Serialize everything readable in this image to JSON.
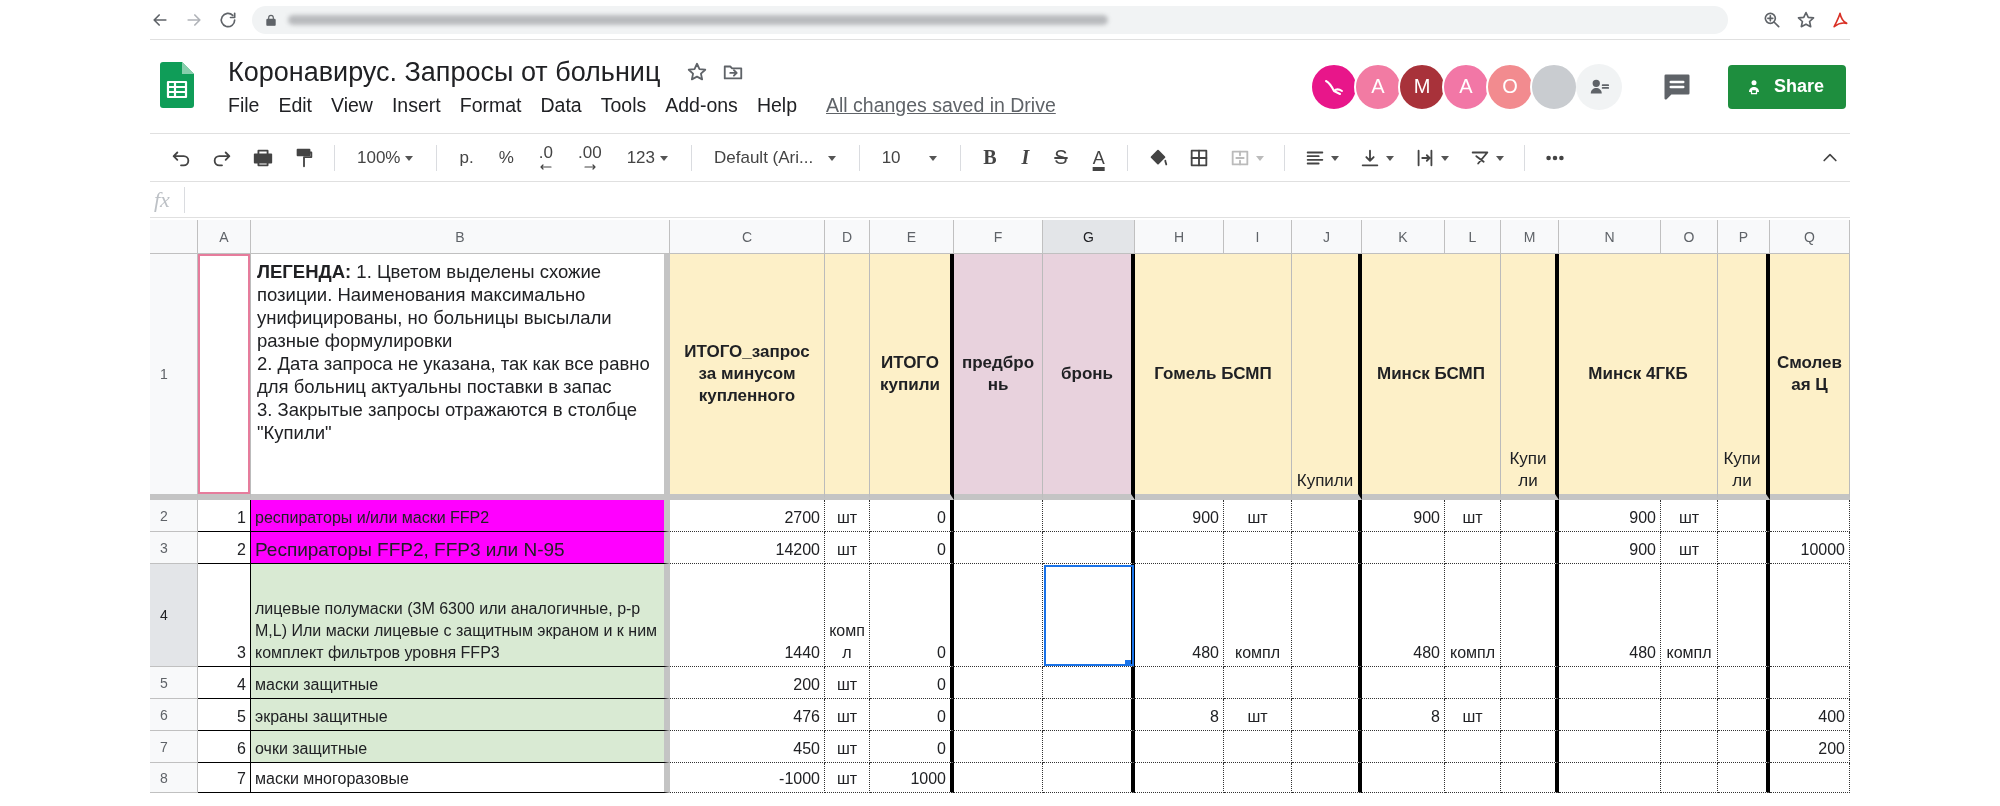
{
  "app": {
    "title": "Коронавирус. Запросы от больниц",
    "menu": [
      "File",
      "Edit",
      "View",
      "Insert",
      "Format",
      "Data",
      "Tools",
      "Add-ons",
      "Help"
    ],
    "save_status": "All changes saved in Drive",
    "collaborators": [
      {
        "kind": "animal",
        "color": "#e8168a"
      },
      {
        "kind": "letter",
        "initial": "A",
        "color": "#f27ba3"
      },
      {
        "kind": "letter",
        "initial": "M",
        "color": "#a8323a"
      },
      {
        "kind": "letter",
        "initial": "A",
        "color": "#f277a6"
      },
      {
        "kind": "letter",
        "initial": "O",
        "color": "#f28b8f"
      },
      {
        "kind": "photo"
      }
    ],
    "share_button": "Share"
  },
  "toolbar": {
    "zoom": "100%",
    "currency": "р.",
    "percent": "%",
    "decrease_decimals": ".0",
    "increase_decimals": ".00",
    "number_format": "123",
    "font": "Default (Ari...",
    "font_size": "10",
    "bold": "B",
    "italic": "I",
    "strikethrough": "S",
    "text_color": "A"
  },
  "formula_bar": {
    "label": "fx"
  },
  "sheet": {
    "columns": [
      {
        "letter": "A",
        "selected": false
      },
      {
        "letter": "B",
        "selected": false
      },
      {
        "letter": "C",
        "selected": false
      },
      {
        "letter": "D",
        "selected": false
      },
      {
        "letter": "E",
        "selected": false
      },
      {
        "letter": "F",
        "selected": false
      },
      {
        "letter": "G",
        "selected": true
      },
      {
        "letter": "H",
        "selected": false
      },
      {
        "letter": "I",
        "selected": false
      },
      {
        "letter": "J",
        "selected": false
      },
      {
        "letter": "K",
        "selected": false
      },
      {
        "letter": "L",
        "selected": false
      },
      {
        "letter": "M",
        "selected": false
      },
      {
        "letter": "N",
        "selected": false
      },
      {
        "letter": "O",
        "selected": false
      },
      {
        "letter": "P",
        "selected": false
      },
      {
        "letter": "Q",
        "selected": false
      }
    ],
    "rows": [
      {
        "number": "1",
        "selected": false,
        "cells": [
          {
            "kind": "empty",
            "selected": false,
            "collaborator_cursor": true
          },
          {
            "kind": "legend",
            "text": "**ЛЕГЕНДА:** 1. Цветом выделены схожие позиции. Наименования максимально унифицированы, но больницы высылали разные формулировки\n2. Дата запроса не указана, так как все равно для больниц актуальны поставки в запас\n3. Закрытые запросы отражаются в столбце \"Купили\"",
            "selected": false
          },
          {
            "kind": "header",
            "text": "ИТОГО_запрос за минусом купленного",
            "color": "#fdf0c8",
            "selected": false
          },
          {
            "kind": "empty",
            "color": "#fdf0c8",
            "selected": false
          },
          {
            "kind": "header",
            "text": "ИТОГО купили",
            "color": "#fdf0c8",
            "selected": false
          },
          {
            "kind": "header",
            "text": "предбронь",
            "color": "#e8d2dd",
            "selected": false
          },
          {
            "kind": "header",
            "text": "бронь",
            "color": "#e8d2dd",
            "selected": false
          },
          {
            "kind": "header",
            "text": "Гомель БСМП",
            "color": "#fdf0c8",
            "merged": true,
            "selected": false
          },
          {
            "kind": "covered"
          },
          {
            "kind": "note",
            "text": "Купили",
            "color": "#fdf0c8",
            "selected": false
          },
          {
            "kind": "header",
            "text": "Минск БСМП",
            "color": "#fdf0c8",
            "merged": true,
            "selected": false
          },
          {
            "kind": "covered"
          },
          {
            "kind": "note",
            "text": "Купили",
            "color": "#fdf0c8",
            "selected": false
          },
          {
            "kind": "header",
            "text": "Минск 4ГКБ",
            "color": "#fdf0c8",
            "merged": true,
            "selected": false
          },
          {
            "kind": "covered"
          },
          {
            "kind": "note",
            "text": "Купили",
            "color": "#fdf0c8",
            "selected": false
          },
          {
            "kind": "header",
            "text": "Смолевая Ц",
            "color": "#fdf0c8",
            "selected": false
          }
        ]
      },
      {
        "number": "2",
        "selected": false,
        "cells": [
          {
            "kind": "index",
            "text": "1",
            "selected": false
          },
          {
            "kind": "item",
            "text": "респираторы и/или маски FFP2",
            "color": "#ff00ff",
            "selected": false
          },
          {
            "kind": "number",
            "text": "2700",
            "selected": false
          },
          {
            "kind": "unit",
            "text": "шт",
            "selected": false
          },
          {
            "kind": "number",
            "text": "0",
            "selected": false
          },
          {
            "kind": "empty",
            "selected": false
          },
          {
            "kind": "empty",
            "selected": false
          },
          {
            "kind": "number",
            "text": "900",
            "selected": false
          },
          {
            "kind": "unit",
            "text": "шт",
            "selected": false
          },
          {
            "kind": "empty",
            "selected": false
          },
          {
            "kind": "number",
            "text": "900",
            "selected": false
          },
          {
            "kind": "unit",
            "text": "шт",
            "selected": false
          },
          {
            "kind": "empty",
            "selected": false
          },
          {
            "kind": "number",
            "text": "900",
            "selected": false
          },
          {
            "kind": "unit",
            "text": "шт",
            "selected": false
          },
          {
            "kind": "empty",
            "selected": false
          },
          {
            "kind": "empty",
            "selected": false
          }
        ]
      },
      {
        "number": "3",
        "selected": false,
        "cells": [
          {
            "kind": "index",
            "text": "2",
            "selected": false
          },
          {
            "kind": "large",
            "text": "Респираторы FFP2, FFP3 или N-95",
            "color": "#ff00ff",
            "selected": false
          },
          {
            "kind": "number",
            "text": "14200",
            "selected": false
          },
          {
            "kind": "unit",
            "text": "шт",
            "selected": false
          },
          {
            "kind": "number",
            "text": "0",
            "selected": false
          },
          {
            "kind": "empty",
            "selected": false
          },
          {
            "kind": "empty",
            "selected": false
          },
          {
            "kind": "empty",
            "selected": false
          },
          {
            "kind": "empty",
            "selected": false
          },
          {
            "kind": "empty",
            "selected": false
          },
          {
            "kind": "empty",
            "selected": false
          },
          {
            "kind": "empty",
            "selected": false
          },
          {
            "kind": "empty",
            "selected": false
          },
          {
            "kind": "number",
            "text": "900",
            "selected": false
          },
          {
            "kind": "unit",
            "text": "шт",
            "selected": false
          },
          {
            "kind": "empty",
            "selected": false
          },
          {
            "kind": "number",
            "text": "10000",
            "selected": false
          }
        ]
      },
      {
        "number": "4",
        "selected": true,
        "cells": [
          {
            "kind": "index",
            "text": "3",
            "selected": false
          },
          {
            "kind": "item",
            "text": "лицевые полумаски (3М 6300 или аналогичные, р-р M,L) Или маски лицевые с защитным экраном и к ним комплект фильтров уровня FFP3",
            "color": "#d9ead3",
            "selected": false
          },
          {
            "kind": "number",
            "text": "1440",
            "selected": false
          },
          {
            "kind": "unit",
            "text": "компл",
            "selected": false
          },
          {
            "kind": "number",
            "text": "0",
            "selected": false
          },
          {
            "kind": "empty",
            "selected": false
          },
          {
            "kind": "empty",
            "selected": true
          },
          {
            "kind": "number",
            "text": "480",
            "selected": false
          },
          {
            "kind": "unit",
            "text": "компл",
            "selected": false
          },
          {
            "kind": "empty",
            "selected": false
          },
          {
            "kind": "number",
            "text": "480",
            "selected": false
          },
          {
            "kind": "unit",
            "text": "компл",
            "selected": false
          },
          {
            "kind": "empty",
            "selected": false
          },
          {
            "kind": "number",
            "text": "480",
            "selected": false
          },
          {
            "kind": "unit",
            "text": "компл",
            "selected": false
          },
          {
            "kind": "empty",
            "selected": false
          },
          {
            "kind": "empty",
            "selected": false
          }
        ]
      },
      {
        "number": "5",
        "selected": false,
        "cells": [
          {
            "kind": "index",
            "text": "4",
            "selected": false
          },
          {
            "kind": "item",
            "text": "маски защитные",
            "color": "#d9ead3",
            "selected": false
          },
          {
            "kind": "number",
            "text": "200",
            "selected": false
          },
          {
            "kind": "unit",
            "text": "шт",
            "selected": false
          },
          {
            "kind": "number",
            "text": "0",
            "selected": false
          },
          {
            "kind": "empty",
            "selected": false
          },
          {
            "kind": "empty",
            "selected": false
          },
          {
            "kind": "empty",
            "selected": false
          },
          {
            "kind": "empty",
            "selected": false
          },
          {
            "kind": "empty",
            "selected": false
          },
          {
            "kind": "empty",
            "selected": false
          },
          {
            "kind": "empty",
            "selected": false
          },
          {
            "kind": "empty",
            "selected": false
          },
          {
            "kind": "empty",
            "selected": false
          },
          {
            "kind": "empty",
            "selected": false
          },
          {
            "kind": "empty",
            "selected": false
          },
          {
            "kind": "empty",
            "selected": false
          }
        ]
      },
      {
        "number": "6",
        "selected": false,
        "cells": [
          {
            "kind": "index",
            "text": "5",
            "selected": false
          },
          {
            "kind": "item",
            "text": "экраны защитные",
            "color": "#d9ead3",
            "selected": false
          },
          {
            "kind": "number",
            "text": "476",
            "selected": false
          },
          {
            "kind": "unit",
            "text": "шт",
            "selected": false
          },
          {
            "kind": "number",
            "text": "0",
            "selected": false
          },
          {
            "kind": "empty",
            "selected": false
          },
          {
            "kind": "empty",
            "selected": false
          },
          {
            "kind": "number",
            "text": "8",
            "selected": false
          },
          {
            "kind": "unit",
            "text": "шт",
            "selected": false
          },
          {
            "kind": "empty",
            "selected": false
          },
          {
            "kind": "number",
            "text": "8",
            "selected": false
          },
          {
            "kind": "unit",
            "text": "шт",
            "selected": false
          },
          {
            "kind": "empty",
            "selected": false
          },
          {
            "kind": "empty",
            "selected": false
          },
          {
            "kind": "empty",
            "selected": false
          },
          {
            "kind": "empty",
            "selected": false
          },
          {
            "kind": "number",
            "text": "400",
            "selected": false
          }
        ]
      },
      {
        "number": "7",
        "selected": false,
        "cells": [
          {
            "kind": "index",
            "text": "6",
            "selected": false
          },
          {
            "kind": "item",
            "text": "очки защитные",
            "color": "#d9ead3",
            "selected": false
          },
          {
            "kind": "number",
            "text": "450",
            "selected": false
          },
          {
            "kind": "unit",
            "text": "шт",
            "selected": false
          },
          {
            "kind": "number",
            "text": "0",
            "selected": false
          },
          {
            "kind": "empty",
            "selected": false
          },
          {
            "kind": "empty",
            "selected": false
          },
          {
            "kind": "empty",
            "selected": false
          },
          {
            "kind": "empty",
            "selected": false
          },
          {
            "kind": "empty",
            "selected": false
          },
          {
            "kind": "empty",
            "selected": false
          },
          {
            "kind": "empty",
            "selected": false
          },
          {
            "kind": "empty",
            "selected": false
          },
          {
            "kind": "empty",
            "selected": false
          },
          {
            "kind": "empty",
            "selected": false
          },
          {
            "kind": "empty",
            "selected": false
          },
          {
            "kind": "number",
            "text": "200",
            "selected": false
          }
        ]
      },
      {
        "number": "8",
        "selected": false,
        "cells": [
          {
            "kind": "index",
            "text": "7",
            "selected": false
          },
          {
            "kind": "item",
            "text": "маски многоразовые",
            "selected": false
          },
          {
            "kind": "number",
            "text": "-1000",
            "selected": false
          },
          {
            "kind": "unit",
            "text": "шт",
            "selected": false
          },
          {
            "kind": "number",
            "text": "1000",
            "selected": false
          },
          {
            "kind": "empty",
            "selected": false
          },
          {
            "kind": "empty",
            "selected": false
          },
          {
            "kind": "empty",
            "selected": false
          },
          {
            "kind": "empty",
            "selected": false
          },
          {
            "kind": "empty",
            "selected": false
          },
          {
            "kind": "empty",
            "selected": false
          },
          {
            "kind": "empty",
            "selected": false
          },
          {
            "kind": "empty",
            "selected": false
          },
          {
            "kind": "empty",
            "selected": false
          },
          {
            "kind": "empty",
            "selected": false
          },
          {
            "kind": "empty",
            "selected": false
          },
          {
            "kind": "empty",
            "selected": false
          }
        ]
      }
    ]
  }
}
